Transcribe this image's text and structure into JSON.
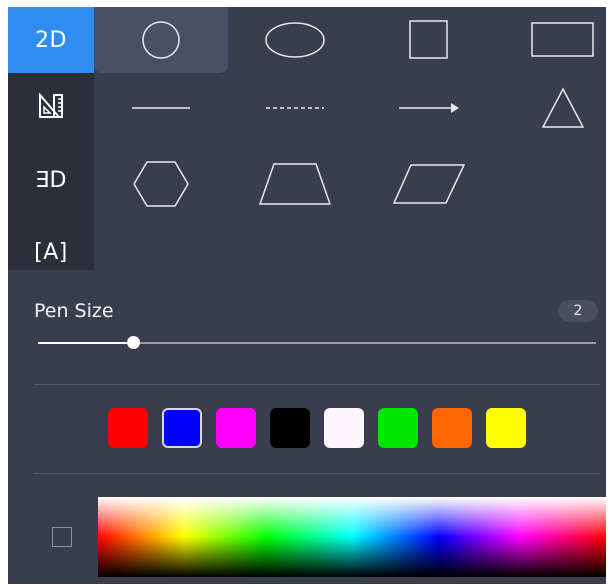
{
  "tool_tabs": [
    {
      "id": "2d",
      "label": "2D",
      "icon": "2d-text-icon",
      "active": true
    },
    {
      "id": "ruler",
      "label": "",
      "icon": "ruler-set-square-icon",
      "active": false
    },
    {
      "id": "3d",
      "label": "∃D",
      "icon": "3d-text-icon",
      "active": false
    },
    {
      "id": "text",
      "label": "[A]",
      "icon": "text-box-icon",
      "active": false
    }
  ],
  "shapes": [
    {
      "name": "circle",
      "icon": "circle-icon",
      "selected": true
    },
    {
      "name": "ellipse",
      "icon": "ellipse-icon",
      "selected": false
    },
    {
      "name": "square",
      "icon": "square-icon",
      "selected": false
    },
    {
      "name": "rectangle",
      "icon": "rectangle-icon",
      "selected": false
    },
    {
      "name": "line",
      "icon": "line-icon",
      "selected": false
    },
    {
      "name": "dashed-line",
      "icon": "dashed-line-icon",
      "selected": false
    },
    {
      "name": "arrow",
      "icon": "arrow-icon",
      "selected": false
    },
    {
      "name": "triangle",
      "icon": "triangle-icon",
      "selected": false
    },
    {
      "name": "hexagon",
      "icon": "hexagon-icon",
      "selected": false
    },
    {
      "name": "trapezoid",
      "icon": "trapezoid-icon",
      "selected": false
    },
    {
      "name": "parallelogram",
      "icon": "parallelogram-icon",
      "selected": false
    }
  ],
  "pen_size": {
    "label": "Pen Size",
    "value_text": "2",
    "fraction": 0.17
  },
  "colors": {
    "swatches": [
      "#ff0000",
      "#0000ff",
      "#ff00ff",
      "#000000",
      "#fff5fa",
      "#00e600",
      "#ff6600",
      "#ffff00"
    ],
    "selected": 1
  },
  "theme": {
    "panel_bg": "#3a3d4e",
    "tool_col_bg": "#2c2e3a",
    "accent": "#2f8cf0",
    "selected_cell": "#4a4f66"
  }
}
